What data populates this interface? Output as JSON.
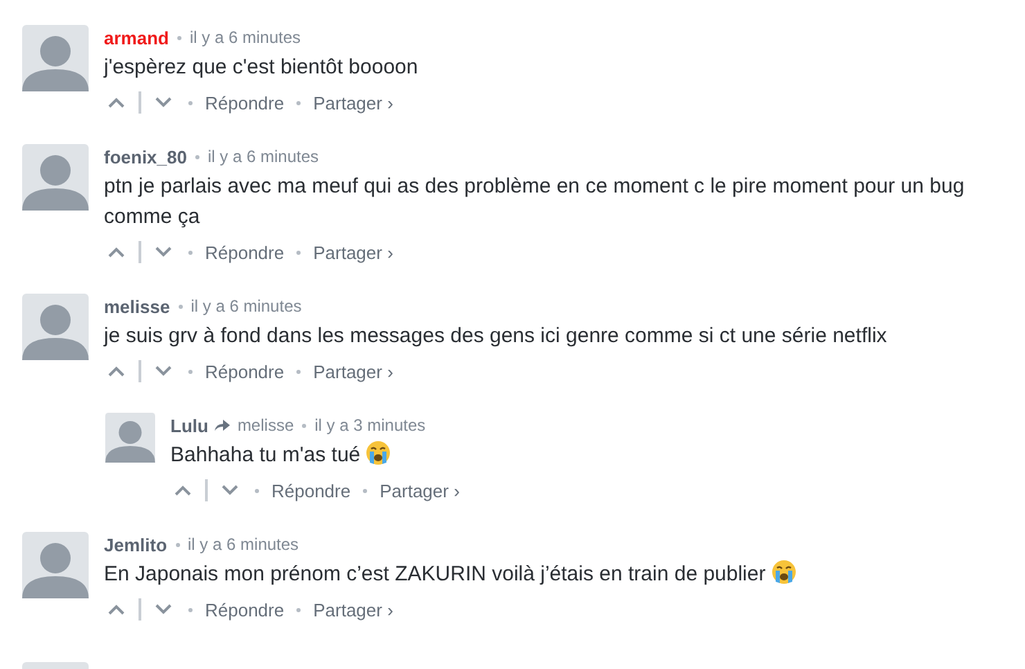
{
  "comments": [
    {
      "kind": "comment",
      "author": "armand",
      "color": "#f01a1a",
      "time": "il y a 6 minutes",
      "text": "j'espèrez que c'est bientôt boooon",
      "reply_label": "Répondre",
      "share_label": "Partager ›"
    },
    {
      "kind": "comment",
      "author": "foenix_80",
      "color": "#5b6471",
      "time": "il y a 6 minutes",
      "text": "ptn je parlais avec ma meuf qui as des problème en ce moment c le pire moment pour un bug comme ça",
      "reply_label": "Répondre",
      "share_label": "Partager ›"
    },
    {
      "kind": "comment",
      "author": "melisse",
      "color": "#5b6471",
      "time": "il y a 6 minutes",
      "text": "je suis grv à fond dans les messages des gens ici genre comme si ct une série netflix",
      "reply_label": "Répondre",
      "share_label": "Partager ›"
    },
    {
      "kind": "reply",
      "author": "Lulu",
      "color": "#5b6471",
      "reply_to": "melisse",
      "time": "il y a 3 minutes",
      "text": "Bahhaha tu m'as tué",
      "crying_emoji": true,
      "reply_label": "Répondre",
      "share_label": "Partager ›"
    },
    {
      "kind": "comment",
      "author": "Jemlito",
      "color": "#5b6471",
      "time": "il y a 6 minutes",
      "text": "En Japonais mon prénom c’est ZAKURIN voilà j’étais en train de publier",
      "crying_emoji": true,
      "reply_label": "Répondre",
      "share_label": "Partager ›"
    },
    {
      "kind": "partial"
    }
  ]
}
